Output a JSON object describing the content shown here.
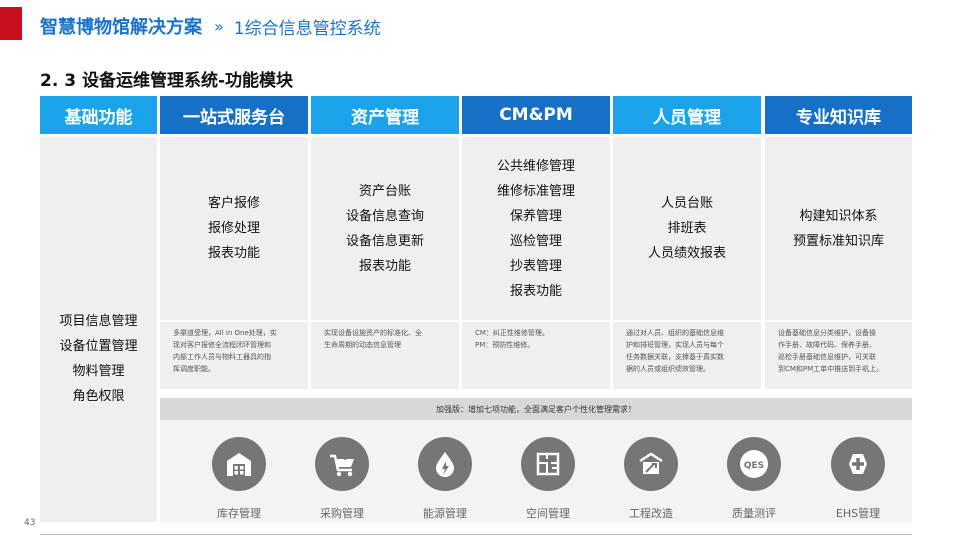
{
  "header": {
    "title": "智慧博物馆解决方案",
    "separator": "»",
    "subtitle": "1综合信息管控系统",
    "accent_color": "#c8101e",
    "brand_color": "#1a73c9"
  },
  "section_title": "2. 3 设备运维管理系统-功能模块",
  "columns": [
    {
      "header": "基础功能",
      "items": [
        "项目信息管理",
        "设备位置管理",
        "物料管理",
        "角色权限"
      ],
      "description": []
    },
    {
      "header": "一站式服务台",
      "items": [
        "客户报修",
        "报修处理",
        "报表功能"
      ],
      "description": [
        "多渠道受理，All in One处理，实",
        "现对客户报修全流程闭环管理和",
        "内部工作人员与物料工器具的指",
        "挥调度职能。"
      ]
    },
    {
      "header": "资产管理",
      "items": [
        "资产台账",
        "设备信息查询",
        "设备信息更新",
        "报表功能"
      ],
      "description": [
        "实现设备设施资产的标准化、全",
        "生命周期的动态信息管理"
      ]
    },
    {
      "header": "CM&PM",
      "items": [
        "公共维修管理",
        "维修标准管理",
        "保养管理",
        "巡检管理",
        "抄表管理",
        "报表功能"
      ],
      "description": [
        "CM：纠正性维修管理。",
        "PM：预防性维修。"
      ]
    },
    {
      "header": "人员管理",
      "items": [
        "人员台账",
        "排班表",
        "人员绩效报表"
      ],
      "description": [
        "通过对人员、组织的基础信息维",
        "护和排班管理，实现人员与每个",
        "任务数据关联，支撑基于真实数",
        "据的人员或组织绩效管理。"
      ]
    },
    {
      "header": "专业知识库",
      "items": [
        "构建知识体系",
        "预置标准知识库"
      ],
      "description": [
        "设备基础信息分类维护，设备操",
        "作手册、故障代码、保养手册、",
        "巡检手册基础信息维护，可关联",
        "到CM和PM工单中推送到手机上。"
      ]
    }
  ],
  "enhance_text": "加强版：增加七项功能，全面满足客户个性化管理需求！",
  "features": [
    {
      "label": "库存管理",
      "icon": "warehouse-icon"
    },
    {
      "label": "采购管理",
      "icon": "shopping-cart-icon"
    },
    {
      "label": "能源管理",
      "icon": "energy-drop-icon"
    },
    {
      "label": "空间管理",
      "icon": "floor-plan-icon"
    },
    {
      "label": "工程改造",
      "icon": "construction-icon"
    },
    {
      "label": "质量测评",
      "icon": "qes-badge-icon",
      "badge": "QES"
    },
    {
      "label": "EHS管理",
      "icon": "plus-cross-icon"
    }
  ],
  "page_number": "43"
}
